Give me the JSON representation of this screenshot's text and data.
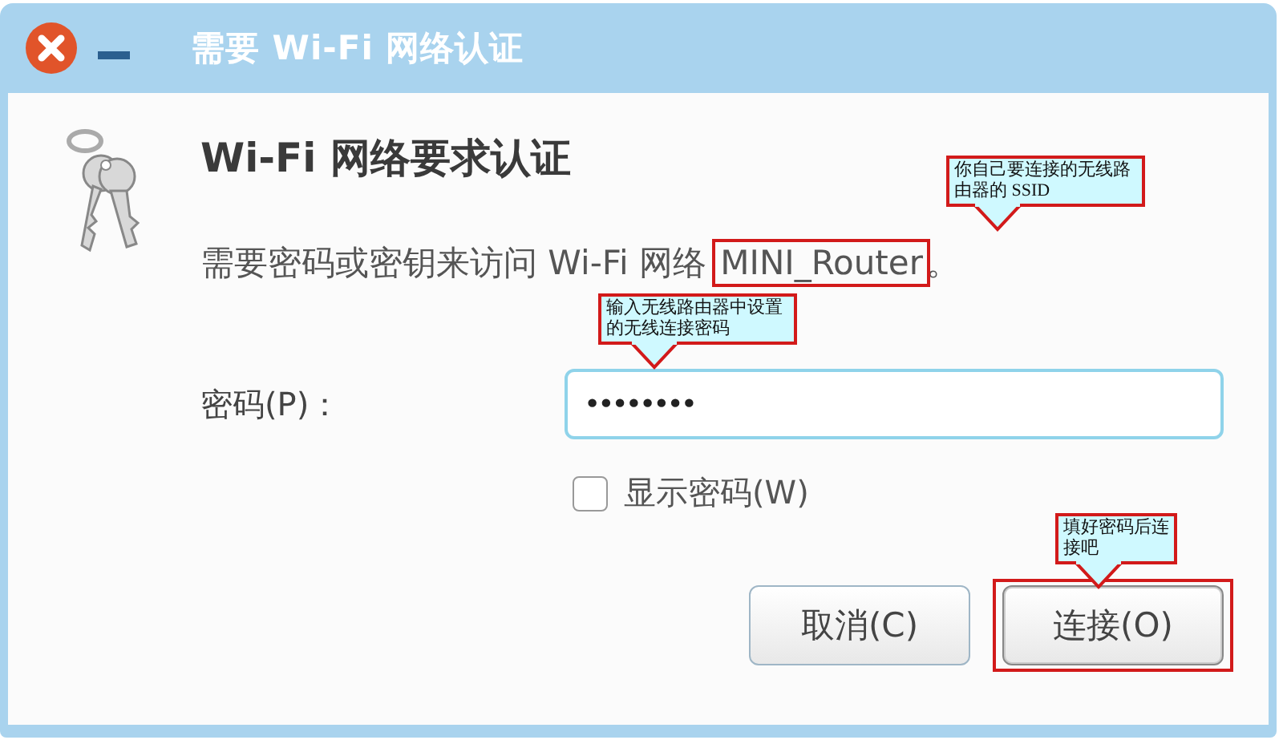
{
  "window": {
    "title": "需要 Wi-Fi 网络认证"
  },
  "heading": "Wi-Fi 网络要求认证",
  "message": {
    "text": "需要密码或密钥来访问 Wi-Fi 网络",
    "ssid": "MINI_Router",
    "end": "。"
  },
  "password": {
    "label": "密码(P)：",
    "value": "••••••••"
  },
  "show_password": {
    "label": "显示密码(W)",
    "checked": false
  },
  "buttons": [
    {
      "label": "取消(C)",
      "highlighted": false
    },
    {
      "label": "连接(O)",
      "highlighted": true
    }
  ],
  "annotations": [
    {
      "text": "你自己要连接的无线路由器的 SSID"
    },
    {
      "text": "输入无线路由器中设置的无线连接密码"
    },
    {
      "text": "填好密码后连接吧"
    }
  ]
}
